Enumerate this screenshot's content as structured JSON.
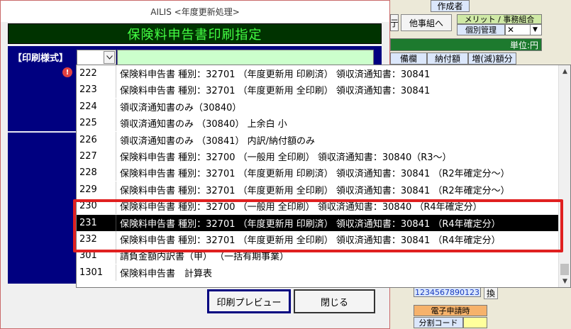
{
  "background": {
    "creator_label": "作成者",
    "other_office_btn": "他事組へ",
    "merit_label": "メリット / 事務組合",
    "individual_mgmt": "個別管理",
    "select_value": "✕",
    "unit_label": "単位:円",
    "col_prep": "備欄",
    "col_paid": "納付額",
    "col_diff": "増(減)額分",
    "id_number": "1234567890123",
    "swap_btn": "換",
    "e_filing_label": "電子申請時",
    "split_code_label": "分割コード",
    "partial_tab": "亍"
  },
  "dialog": {
    "window_title": "AILIS <年度更新処理>",
    "header_title": "保険料申告書印刷指定",
    "format_label": "【印刷様式】",
    "warning_icon_text": "!",
    "preview_button": "印刷プレビュー",
    "close_button": "閉じる"
  },
  "dropdown": {
    "selected_index": 9,
    "items": [
      {
        "code": "222",
        "text": "保険料申告書 種別：32701 （年度更新用 印刷済） 領収済通知書：30841"
      },
      {
        "code": "223",
        "text": "保険料申告書 種別：32701 （年度更新用 全印刷） 領収済通知書：30841"
      },
      {
        "code": "224",
        "text": "領収済通知書のみ（30840）"
      },
      {
        "code": "225",
        "text": "領収済通知書のみ （30840） 上余白 小"
      },
      {
        "code": "226",
        "text": "領収済通知書のみ （30841） 内訳/納付額のみ"
      },
      {
        "code": "227",
        "text": "保険料申告書 種別：32700 （一般用 全印刷） 領収済通知書：30840（R3～）"
      },
      {
        "code": "228",
        "text": "保険料申告書 種別：32701 （年度更新用 印刷済） 領収済通知書：30841 （R2年確定分～）"
      },
      {
        "code": "229",
        "text": "保険料申告書 種別：32701 （年度更新用 全印刷） 領収済通知書：30841 （R2年確定分～）"
      },
      {
        "code": "230",
        "text": "保険料申告書 種別：32700 （一般用 全印刷） 領収済通知書：30840 （R4年確定分）"
      },
      {
        "code": "231",
        "text": "保険料申告書 種別：32701 （年度更新用 印刷済） 領収済通知書：30841 （R4年確定分）"
      },
      {
        "code": "232",
        "text": "保険料申告書 種別：32701 （年度更新用 全印刷） 領収済通知書：30841 （R4年確定分）"
      },
      {
        "code": "301",
        "text": "請負金額内訳書（甲） （一括有期事業）"
      },
      {
        "code": "1301",
        "text": "保険料申告書　計算表"
      }
    ]
  },
  "colors": {
    "header_bg": "#003300",
    "header_text": "#44ff44",
    "panel_bg": "#000080",
    "highlight": "#e02020",
    "selected_bg": "#000000"
  }
}
